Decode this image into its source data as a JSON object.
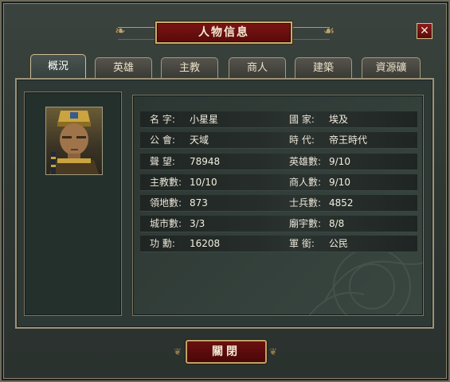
{
  "window": {
    "title": "人物信息",
    "close_symbol": "✕"
  },
  "tabs": [
    {
      "label": "概況",
      "active": true
    },
    {
      "label": "英雄",
      "active": false
    },
    {
      "label": "主教",
      "active": false
    },
    {
      "label": "商人",
      "active": false
    },
    {
      "label": "建築",
      "active": false
    },
    {
      "label": "資源礦",
      "active": false
    }
  ],
  "info_rows": [
    {
      "left_label": "名 字:",
      "left_value": "小星星",
      "right_label": "國 家:",
      "right_value": "埃及"
    },
    {
      "left_label": "公 會:",
      "left_value": "天域",
      "right_label": "時 代:",
      "right_value": "帝王時代"
    },
    {
      "left_label": "聲 望:",
      "left_value": "78948",
      "right_label": "英雄數:",
      "right_value": "9/10"
    },
    {
      "left_label": "主教數:",
      "left_value": "10/10",
      "right_label": "商人數:",
      "right_value": "9/10"
    },
    {
      "left_label": "領地數:",
      "left_value": "873",
      "right_label": "士兵數:",
      "right_value": "4852"
    },
    {
      "left_label": "城市數:",
      "left_value": "3/3",
      "right_label": "廟宇數:",
      "right_value": "8/8"
    },
    {
      "left_label": "功 勳:",
      "left_value": "16208",
      "right_label": "軍 銜:",
      "right_value": "公民"
    }
  ],
  "footer": {
    "close_label": "關閉"
  },
  "colors": {
    "accent_red": "#6a1010",
    "gold_border": "#bfa36a",
    "panel_bg": "#2e3834"
  },
  "icons": {
    "close": "close-icon",
    "portrait": "pharaoh-portrait"
  }
}
